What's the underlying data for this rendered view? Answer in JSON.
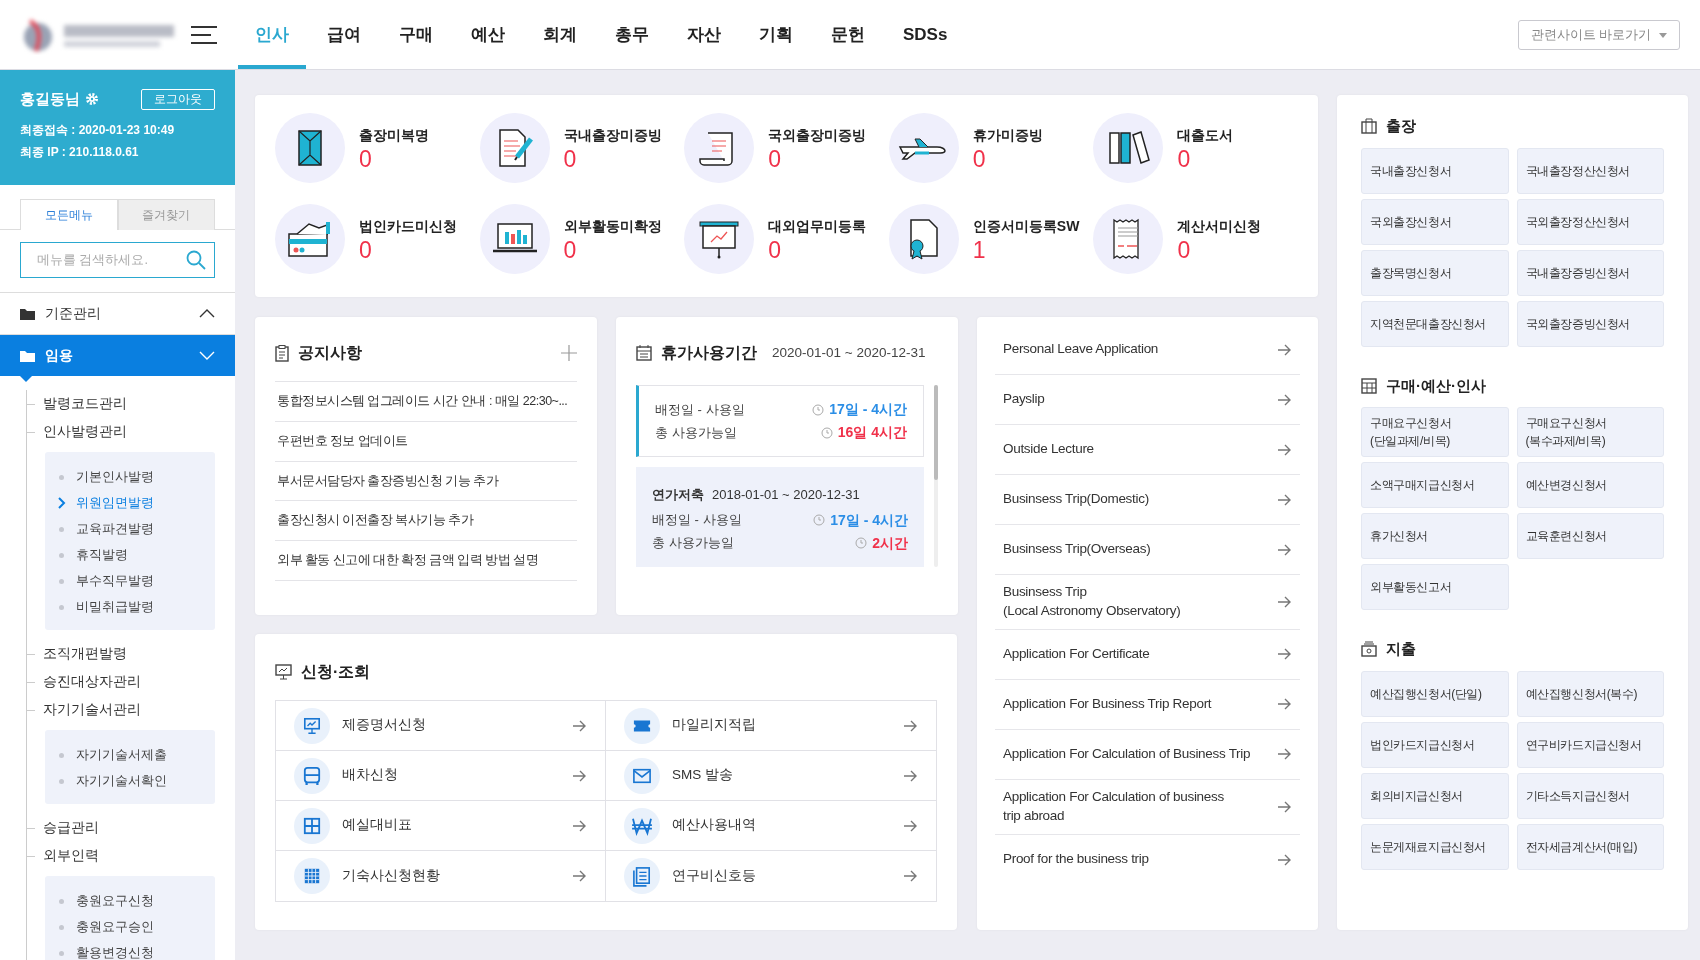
{
  "header": {
    "nav": [
      {
        "label": "인사",
        "selected": true
      },
      {
        "label": "급여",
        "selected": false
      },
      {
        "label": "구매",
        "selected": false
      },
      {
        "label": "예산",
        "selected": false
      },
      {
        "label": "회계",
        "selected": false
      },
      {
        "label": "총무",
        "selected": false
      },
      {
        "label": "자산",
        "selected": false
      },
      {
        "label": "기획",
        "selected": false
      },
      {
        "label": "문헌",
        "selected": false
      },
      {
        "label": "SDSs",
        "selected": false
      }
    ],
    "related_sites_button": "관련사이트 바로가기"
  },
  "profile": {
    "name": "홍길동님",
    "logout_button": "로그아웃",
    "last_access": "최종접속 : 2020-01-23 10:49",
    "last_ip": "최종 IP : 210.118.0.61"
  },
  "sidebar": {
    "tabs": [
      {
        "label": "모든메뉴",
        "selected": true
      },
      {
        "label": "즐겨찾기",
        "selected": false
      }
    ],
    "search": {
      "placeholder": "메뉴를 검색하세요."
    },
    "groups": [
      {
        "label": "기준관리",
        "expanded": false,
        "selected": false
      },
      {
        "label": "임용",
        "expanded": true,
        "selected": true,
        "children": [
          {
            "label": "발령코드관리",
            "selected": false
          },
          {
            "label": "인사발령관리",
            "selected": false,
            "children": [
              {
                "label": "기본인사발령",
                "selected": false
              },
              {
                "label": "위원임면발령",
                "selected": true
              },
              {
                "label": "교육파견발령",
                "selected": false
              },
              {
                "label": "휴직발령",
                "selected": false
              },
              {
                "label": "부수직무발령",
                "selected": false
              },
              {
                "label": "비밀취급발령",
                "selected": false
              }
            ]
          },
          {
            "label": "조직개편발령",
            "selected": false
          },
          {
            "label": "승진대상자관리",
            "selected": false
          },
          {
            "label": "자기기술서관리",
            "selected": false,
            "children": [
              {
                "label": "자기기술서제출",
                "selected": false
              },
              {
                "label": "자기기술서확인",
                "selected": false
              }
            ]
          },
          {
            "label": "승급관리",
            "selected": false
          },
          {
            "label": "외부인력",
            "selected": false,
            "children": [
              {
                "label": "충원요구신청",
                "selected": false
              },
              {
                "label": "충원요구승인",
                "selected": false
              },
              {
                "label": "활용변경신청",
                "selected": false
              }
            ]
          }
        ]
      }
    ]
  },
  "stats": [
    {
      "label": "출장미복명",
      "count": "0"
    },
    {
      "label": "국내출장미증빙",
      "count": "0"
    },
    {
      "label": "국외출장미증빙",
      "count": "0"
    },
    {
      "label": "휴가미증빙",
      "count": "0"
    },
    {
      "label": "대출도서",
      "count": "0"
    },
    {
      "label": "법인카드미신청",
      "count": "0"
    },
    {
      "label": "외부활동미확정",
      "count": "0"
    },
    {
      "label": "대외업무미등록",
      "count": "0"
    },
    {
      "label": "인증서미등록SW",
      "count": "1"
    },
    {
      "label": "계산서미신청",
      "count": "0"
    }
  ],
  "notices": {
    "title": "공지사항",
    "items": [
      "통합정보시스템 업그레이드 시간 안내 : 매일 22:30~...",
      "우편번호 정보 업데이트",
      "부서문서담당자 출장증빙신청 기능 추가",
      "출장신청시 이전출장 복사기능 추가",
      "외부 활동 신고에 대한 확정 금액 입력 방법 설명"
    ]
  },
  "leave": {
    "title": "휴가사용기간",
    "period": "2020-01-01 ~ 2020-12-31",
    "blocks": [
      {
        "kind": "current",
        "rows": [
          {
            "label": "배정일 - 사용일",
            "value": "17일 - 4시간",
            "color": "#2b8ee6"
          },
          {
            "label": "총 사용가능일",
            "value": "16일 4시간",
            "color": "#f0314a"
          }
        ]
      },
      {
        "kind": "saved",
        "title": "연가저축",
        "period": "2018-01-01 ~ 2020-12-31",
        "rows": [
          {
            "label": "배정일 - 사용일",
            "value": "17일 - 4시간",
            "color": "#2b8ee6"
          },
          {
            "label": "총 사용가능일",
            "value": "2시간",
            "color": "#f0314a"
          }
        ]
      }
    ]
  },
  "apply": {
    "title": "신청·조회",
    "items": [
      "제증명서신청",
      "마일리지적립",
      "배차신청",
      "SMS 발송",
      "예실대비표",
      "예산사용내역",
      "기숙사신청현황",
      "연구비신호등"
    ]
  },
  "english_links": [
    "Personal Leave Application",
    "Payslip",
    "Outside Lecture",
    "Businsess Trip(Domestic)",
    "Businsess Trip(Overseas)",
    "Businsess Trip\n(Local Astronomy Observatory)",
    "Application For Certificate",
    "Application For Business Trip Report",
    "Application For Calculation of Business Trip",
    "Application For Calculation of business\ntrip abroad",
    "Proof for the business trip"
  ],
  "forms": [
    {
      "title": "출장",
      "items": [
        "국내출장신청서",
        "국내출장정산신청서",
        "국외출장신청서",
        "국외출장정산신청서",
        "출장목명신청서",
        "국내출장증빙신청서",
        "지역천문대출장신청서",
        "국외출장증빙신청서"
      ]
    },
    {
      "title": "구매·예산·인사",
      "items": [
        "구매요구신청서\n(단일과제/비목)",
        "구매요구신청서\n(복수과제/비목)",
        "소액구매지급신청서",
        "예산변경신청서",
        "휴가신청서",
        "교육훈련신청서",
        "외부활동신고서"
      ]
    },
    {
      "title": "지출",
      "items": [
        "예산집행신청서(단일)",
        "예산집행신청서(복수)",
        "법인카드지급신청서",
        "연구비카드지급신청서",
        "회의비지급신청서",
        "기타소득지급신청서",
        "논문게재료지급신청서",
        "전자세금계산서(매입)"
      ]
    }
  ]
}
